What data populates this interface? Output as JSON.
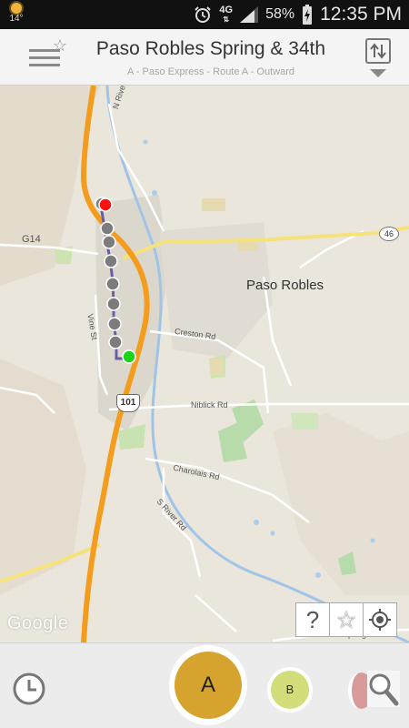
{
  "status_bar": {
    "weather_temp": "14°",
    "network": "4G",
    "battery": "58%",
    "time": "12:35 PM"
  },
  "header": {
    "title": "Paso Robles Spring & 34th",
    "subtitle": "A - Paso Express - Route A - Outward"
  },
  "map": {
    "city_label": "Paso Robles",
    "road_labels": {
      "n_river_rd": "N River Rd",
      "g14": "G14",
      "vine_st": "Vine St",
      "creston_rd": "Creston Rd",
      "niblick_rd": "Niblick Rd",
      "charolais_rd": "Charolais Rd",
      "s_river_rd": "S River Rd",
      "neal_spring_rd": "Neal Spring Rd"
    },
    "highway_101": "101",
    "highway_46": "46",
    "attribution": "Google",
    "route_stops_count": 8
  },
  "map_controls": {
    "help": "?",
    "favorite": "☆"
  },
  "bottom_bar": {
    "route_a": "A",
    "route_b": "B"
  },
  "colors": {
    "route_a": "#d6a42e",
    "route_b": "#d3dd79",
    "route_line": "#6b5ea8",
    "highway": "#f39c1e",
    "start_marker": "#19d419",
    "end_marker": "#ff1111"
  }
}
